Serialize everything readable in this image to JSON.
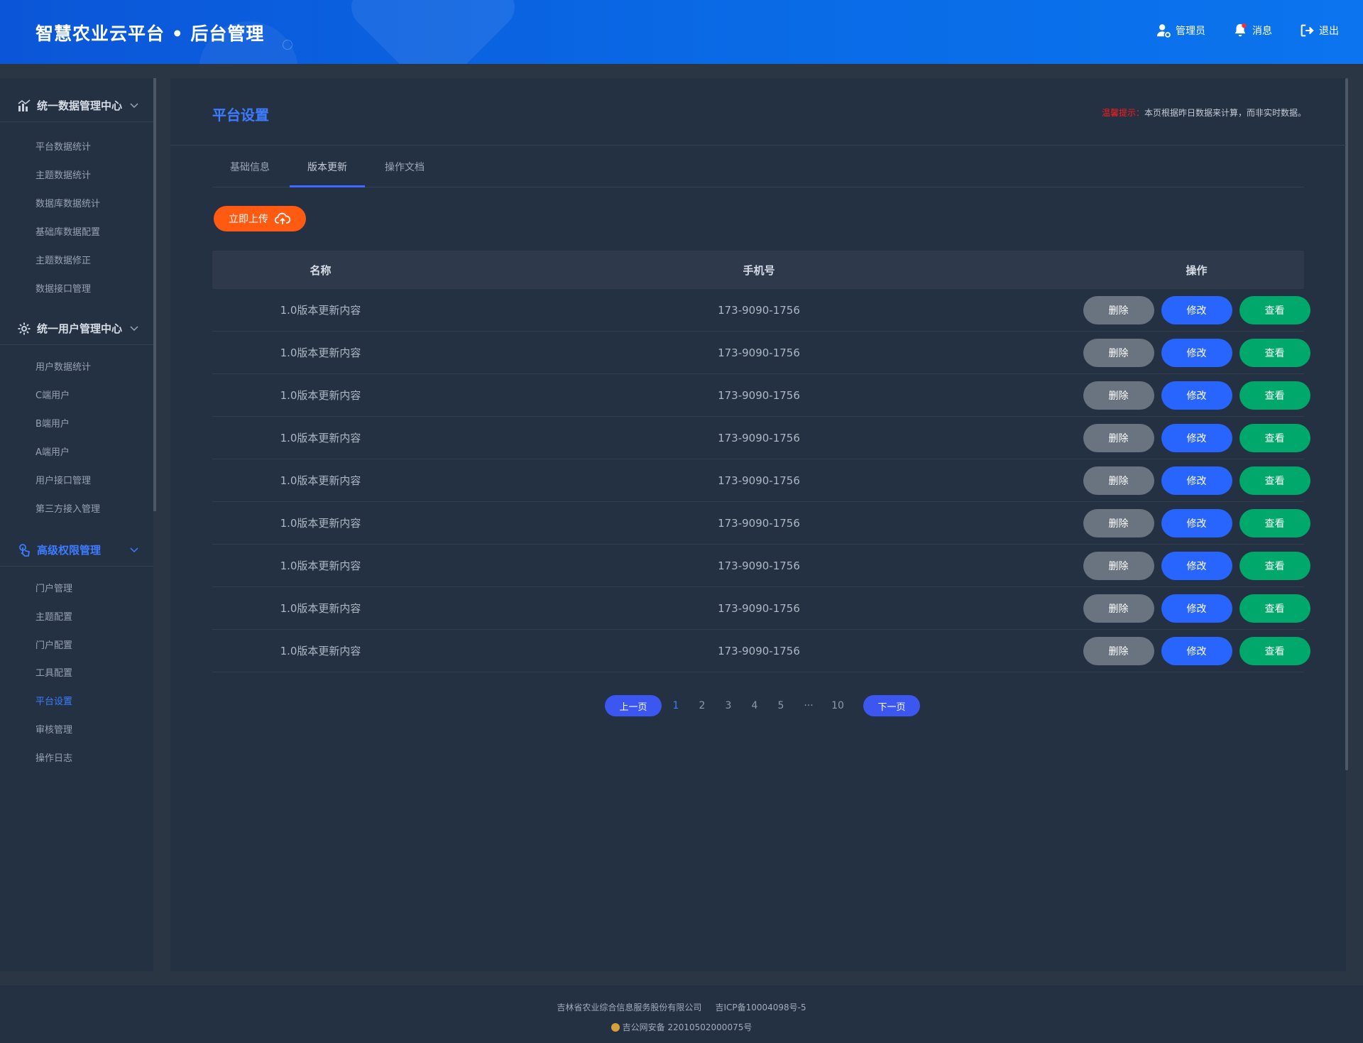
{
  "header": {
    "title": "智慧农业云平台 • 后台管理",
    "admin_label": "管理员",
    "message_label": "消息",
    "logout_label": "退出"
  },
  "sidebar": {
    "groups": [
      {
        "label": "统一数据管理中心",
        "icon": "bar-chart-icon",
        "items": [
          "平台数据统计",
          "主题数据统计",
          "数据库数据统计",
          "基础库数据配置",
          "主题数据修正",
          "数据接口管理"
        ]
      },
      {
        "label": "统一用户管理中心",
        "icon": "gear-icon",
        "items": [
          "用户数据统计",
          "C端用户",
          "B端用户",
          "A端用户",
          "用户接口管理",
          "第三方接入管理"
        ]
      },
      {
        "label": "高级权限管理",
        "icon": "touch-icon",
        "items": [
          "门户管理",
          "主题配置",
          "门户配置",
          "工具配置",
          "平台设置",
          "审核管理",
          "操作日志"
        ]
      }
    ],
    "active_item": "平台设置"
  },
  "main": {
    "page_title": "平台设置",
    "tip_label": "温馨提示：",
    "tip_text": "本页根据昨日数据来计算，而非实时数据。",
    "tabs": [
      "基础信息",
      "版本更新",
      "操作文档"
    ],
    "active_tab": "版本更新",
    "upload_label": "立即上传",
    "table": {
      "headers": [
        "名称",
        "手机号",
        "操作"
      ],
      "rows": [
        {
          "name": "1.0版本更新内容",
          "phone": "173-9090-1756"
        },
        {
          "name": "1.0版本更新内容",
          "phone": "173-9090-1756"
        },
        {
          "name": "1.0版本更新内容",
          "phone": "173-9090-1756"
        },
        {
          "name": "1.0版本更新内容",
          "phone": "173-9090-1756"
        },
        {
          "name": "1.0版本更新内容",
          "phone": "173-9090-1756"
        },
        {
          "name": "1.0版本更新内容",
          "phone": "173-9090-1756"
        },
        {
          "name": "1.0版本更新内容",
          "phone": "173-9090-1756"
        },
        {
          "name": "1.0版本更新内容",
          "phone": "173-9090-1756"
        },
        {
          "name": "1.0版本更新内容",
          "phone": "173-9090-1756"
        }
      ],
      "actions": {
        "delete": "删除",
        "edit": "修改",
        "view": "查看"
      }
    },
    "pagination": {
      "prev": "上一页",
      "next": "下一页",
      "pages": [
        "1",
        "2",
        "3",
        "4",
        "5",
        "···",
        "10"
      ],
      "current": "1"
    }
  },
  "footer": {
    "company": "吉林省农业综合信息服务股份有限公司",
    "icp": "吉ICP备10004098号-5",
    "police": "吉公网安备 22010502000075号"
  },
  "colors": {
    "accent": "#3d7cff",
    "upload": "#ff5a11",
    "delete": "#6a7380",
    "edit": "#2865ff",
    "view": "#00a86b",
    "warn": "#ff1c1c"
  }
}
